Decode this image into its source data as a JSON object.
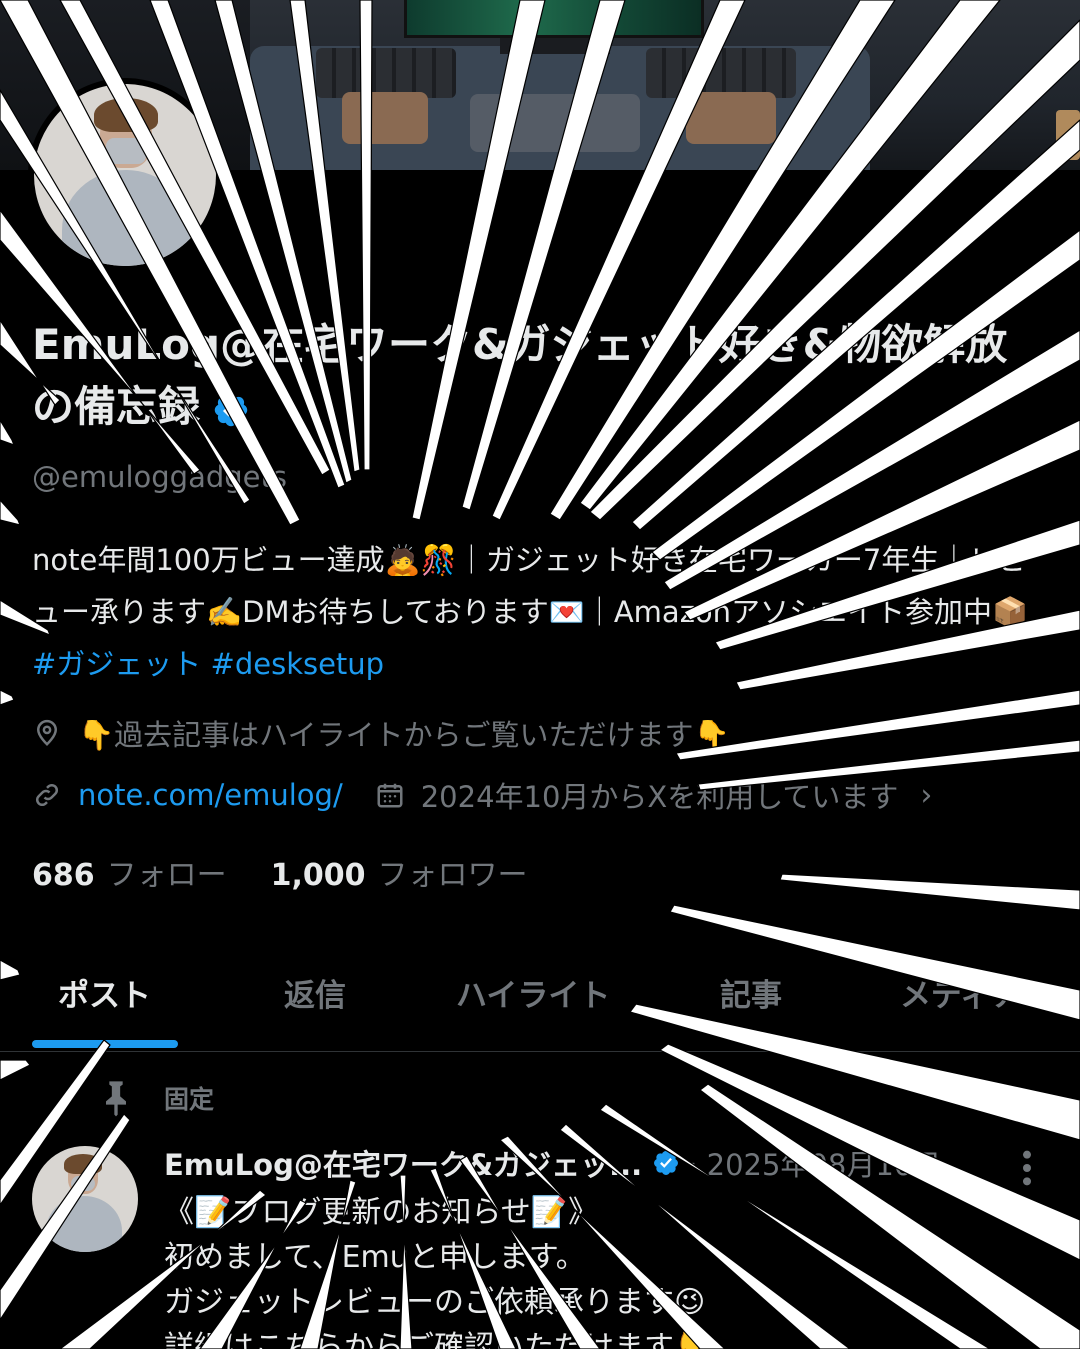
{
  "profile": {
    "display_name": "EmuLog@在宅ワーク&ガジェット好き&物欲解放の備忘録",
    "handle": "@emuloggadgets",
    "bio_text": "note年間100万ビュー達成🙇🎊｜ガジェット好き在宅ワーカー7年生｜レビュー承ります✍️DMお待ちしております💌｜Amazonアソシエイト参加中📦 ",
    "bio_tag1": "#ガジェット",
    "bio_tag2": "#desksetup",
    "location": "👇過去記事はハイライトからご覧いただけます👇",
    "website": "note.com/emulog/",
    "joined": "2024年10月からXを利用しています",
    "following_count": "686",
    "following_label": "フォロー",
    "followers_count": "1,000",
    "followers_label": "フォロワー"
  },
  "tabs": [
    "ポスト",
    "返信",
    "ハイライト",
    "記事",
    "メディア"
  ],
  "pinned_label": "固定",
  "post": {
    "author": "EmuLog@在宅ワーク&ガジェッ...",
    "date": "· 2025年08月16日",
    "body": "《📝ブログ更新のお知らせ📝》\n初めまして、Emuと申します。\nガジェットレビューのご依頼承ります😉\n詳細はこちらからご確認いただけます👇"
  },
  "icons": {
    "verified": "verified-badge-icon",
    "location": "location-pin-icon",
    "link": "link-icon",
    "calendar": "calendar-icon",
    "pin": "pin-icon",
    "more": "more-vertical-icon",
    "chevron": "chevron-right-icon"
  },
  "colors": {
    "background": "#000000",
    "accent": "#1d9bf0",
    "text_primary": "#e7e9ea",
    "text_secondary": "#71767b"
  }
}
